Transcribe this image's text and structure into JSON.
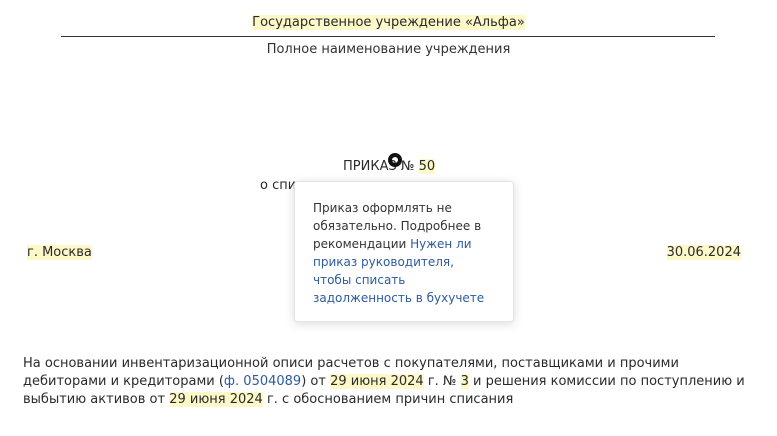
{
  "header": {
    "org_name": "Государственное учреждение «Альфа»",
    "org_caption": "Полное наименование учреждения"
  },
  "order": {
    "title_prefix": "ПРИКАЗ №",
    "number": "50",
    "subject_visible": "о спис"
  },
  "place_date": {
    "city": "г. Москва",
    "date": "30.06.2024"
  },
  "tooltip": {
    "text_before": "Приказ оформлять не обязательно. Подробнее в рекомендации ",
    "link_text": "Нужен ли приказ руководителя, чтобы списать задолженность в бухучете"
  },
  "body": {
    "part1": "На основании инвентаризационной описи расчетов с покупателями, поставщиками и прочими дебиторами и кредиторами (",
    "form_link": "ф. 0504089",
    "part2": ") от ",
    "date1": "29 июня 2024",
    "part3": " г. № ",
    "doc_number": "3",
    "part4": " и решения комиссии по поступлению и выбытию активов от ",
    "date2": "29 июня 2024",
    "part5": " г. с обоснованием причин списания"
  },
  "colors": {
    "highlight": "#fdf8c8",
    "link": "#2e5b9e",
    "text": "#2a2a2a"
  }
}
